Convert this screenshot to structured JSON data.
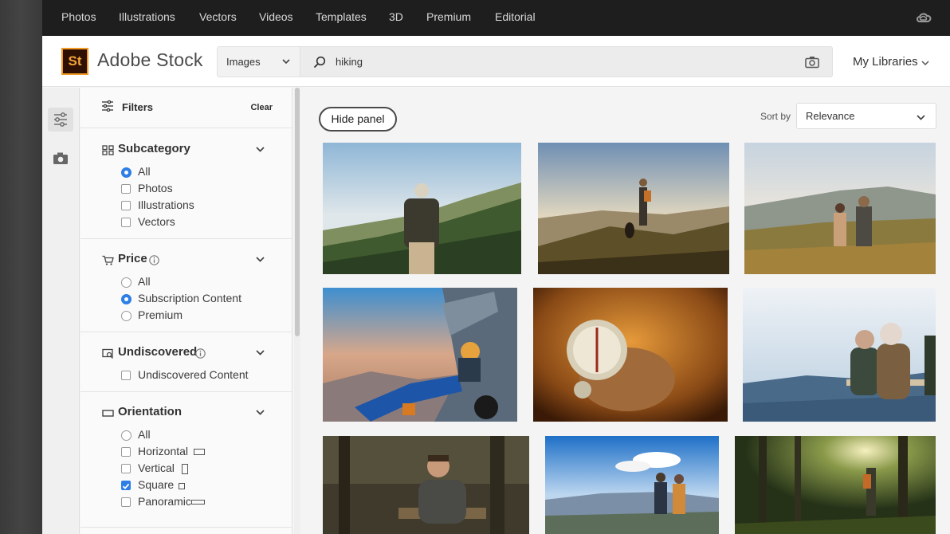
{
  "topnav": {
    "items": [
      "Photos",
      "Illustrations",
      "Vectors",
      "Videos",
      "Templates",
      "3D",
      "Premium",
      "Editorial"
    ],
    "cc_icon": "creative-cloud-icon"
  },
  "header": {
    "logo_mark": "St",
    "logo_text": "Adobe Stock",
    "search_type": "Images",
    "search_value": "hiking",
    "my_libraries": "My Libraries"
  },
  "filters": {
    "title": "Filters",
    "clear": "Clear",
    "subcategory": {
      "title": "Subcategory",
      "options": [
        {
          "label": "All",
          "type": "radio",
          "checked": true
        },
        {
          "label": "Photos",
          "type": "checkbox",
          "checked": false
        },
        {
          "label": "Illustrations",
          "type": "checkbox",
          "checked": false
        },
        {
          "label": "Vectors",
          "type": "checkbox",
          "checked": false
        }
      ]
    },
    "price": {
      "title": "Price",
      "options": [
        {
          "label": "All",
          "type": "radio",
          "checked": false
        },
        {
          "label": "Subscription Content",
          "type": "radio",
          "checked": true
        },
        {
          "label": "Premium",
          "type": "radio",
          "checked": false
        }
      ]
    },
    "undiscovered": {
      "title": "Undiscovered",
      "options": [
        {
          "label": "Undiscovered Content",
          "type": "checkbox",
          "checked": false
        }
      ]
    },
    "orientation": {
      "title": "Orientation",
      "options": [
        {
          "label": "All",
          "type": "radio",
          "checked": false
        },
        {
          "label": "Horizontal",
          "type": "checkbox",
          "checked": false
        },
        {
          "label": "Vertical",
          "type": "checkbox",
          "checked": false
        },
        {
          "label": "Square",
          "type": "checkbox",
          "checked": true
        },
        {
          "label": "Panoramic",
          "type": "checkbox",
          "checked": false
        }
      ]
    }
  },
  "results": {
    "hide_panel": "Hide panel",
    "sort_by_label": "Sort by",
    "sort_value": "Relevance",
    "thumbnails": [
      "hiker-backpack-mountain-ridge",
      "woman-dog-sunset-hill",
      "couple-hiking-autumn-meadow",
      "woman-sitting-on-car-sunset",
      "compass-in-hand",
      "couple-winter-laughing",
      "man-sitting-forest-log",
      "two-hikers-poles-mountains",
      "hiker-sunlit-forest"
    ]
  },
  "colors": {
    "accent_blue": "#2d7ee6",
    "logo_orange": "#f29b26",
    "nav_bg": "#1e1e1e"
  }
}
